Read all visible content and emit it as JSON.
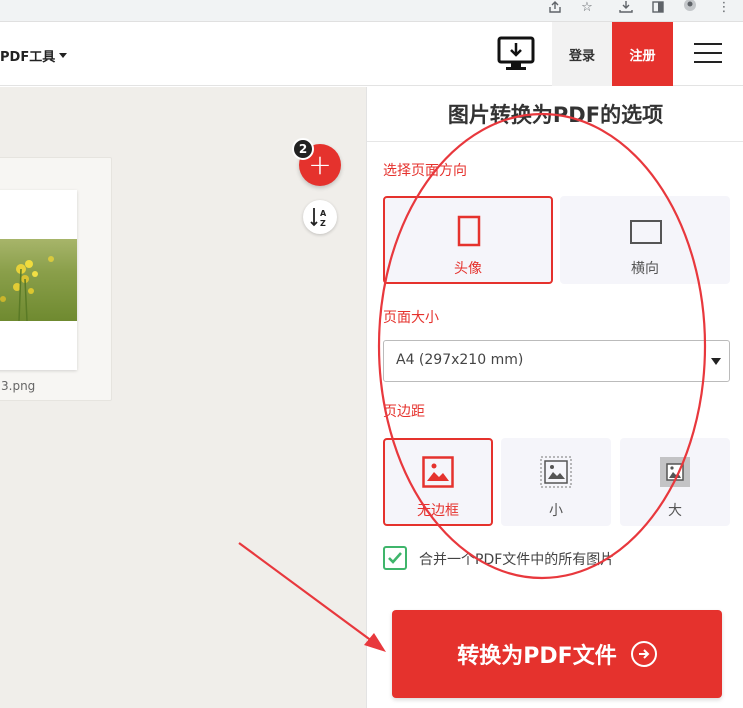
{
  "header": {
    "pdf_tools_label": "PDF工具",
    "login_label": "登录",
    "register_label": "注册"
  },
  "workspace": {
    "file_count": "2",
    "file_name": "3.png"
  },
  "panel": {
    "title": "图片转换为PDF的选项",
    "orientation": {
      "label": "选择页面方向",
      "options": [
        "头像",
        "横向"
      ],
      "selected": "头像"
    },
    "page_size": {
      "label": "页面大小",
      "value": "A4 (297x210 mm)"
    },
    "margin": {
      "label": "页边距",
      "options": [
        "无边框",
        "小",
        "大"
      ],
      "selected": "无边框"
    },
    "merge_label": "合并一个PDF文件中的所有图片",
    "merge_checked": true,
    "convert_label": "转换为PDF文件"
  },
  "colors": {
    "brand_red": "#e5322d",
    "check_green": "#3fb56b",
    "annotation_red": "#e8383d"
  }
}
